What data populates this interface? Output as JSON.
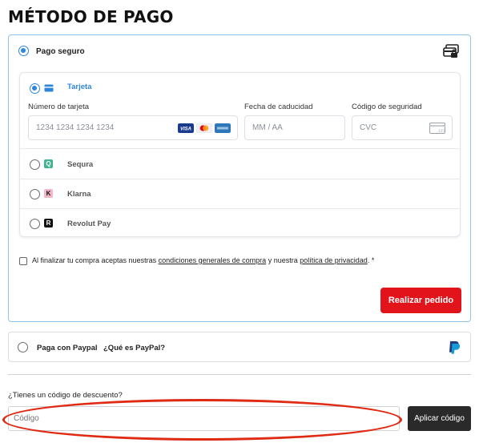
{
  "page": {
    "title": "MÉTODO DE PAGO"
  },
  "secure": {
    "label": "Pago seguro",
    "icon": "secure-card-icon"
  },
  "card": {
    "label": "Tarjeta",
    "number_label": "Número de tarjeta",
    "number_placeholder": "1234 1234 1234 1234",
    "expiry_label": "Fecha de caducidad",
    "expiry_placeholder": "MM / AA",
    "cvc_label": "Código de seguridad",
    "cvc_placeholder": "CVC",
    "logos": [
      "visa",
      "mastercard",
      "amex"
    ]
  },
  "methods": [
    {
      "label": "Sequra",
      "icon": "sequra-icon",
      "color": "#3fb58f",
      "glyph": "Q"
    },
    {
      "label": "Klarna",
      "icon": "klarna-icon",
      "color": "#f4b6c7",
      "glyph": "K"
    },
    {
      "label": "Revolut Pay",
      "icon": "revolut-icon",
      "color": "#111111",
      "glyph": "R"
    }
  ],
  "terms": {
    "prefix": "Al finalizar tu compra aceptas nuestras",
    "link1": "condiciones generales de compra",
    "middle": "y nuestra",
    "link2": "política de privacidad",
    "suffix": ". *"
  },
  "order_button": "Realizar pedido",
  "paypal": {
    "label": "Paga con Paypal",
    "what": "¿Qué es PayPal?"
  },
  "discount": {
    "question": "¿Tienes un código de descuento?",
    "placeholder": "Código",
    "apply": "Aplicar código"
  },
  "colors": {
    "accent": "#2f86d9",
    "primary_button": "#e3131b",
    "annotation": "#e02a14"
  }
}
